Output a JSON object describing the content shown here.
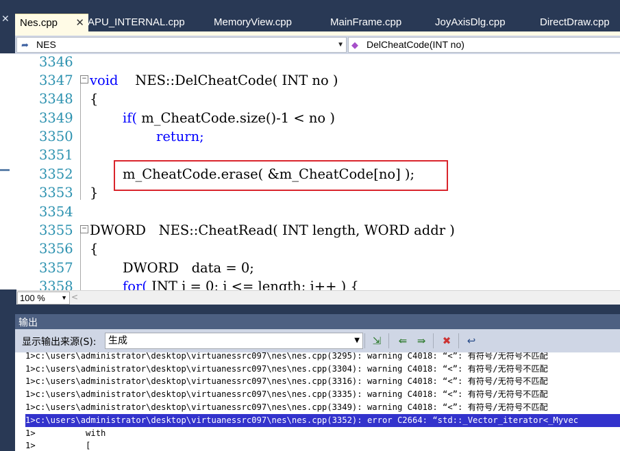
{
  "tabs": [
    {
      "label": "Nes.cpp",
      "active": true
    },
    {
      "label": "APU_INTERNAL.cpp"
    },
    {
      "label": "MemoryView.cpp"
    },
    {
      "label": "MainFrame.cpp"
    },
    {
      "label": "JoyAxisDlg.cpp"
    },
    {
      "label": "DirectDraw.cpp"
    }
  ],
  "tab_close_glyph": "✕",
  "nav": {
    "scope": "NES",
    "member": "DelCheatCode(INT no)"
  },
  "editor": {
    "lines": [
      {
        "num": "3346",
        "text": ""
      },
      {
        "num": "3347",
        "text": "NES::DelCheatCode( INT no )",
        "kw": "void"
      },
      {
        "num": "3348",
        "text": "{"
      },
      {
        "num": "3349",
        "text": "m_CheatCode.size()-1 < no )",
        "kw": "if("
      },
      {
        "num": "3350",
        "text": "",
        "kw": "return;"
      },
      {
        "num": "3351",
        "text": ""
      },
      {
        "num": "3352",
        "text": "m_CheatCode.erase( &m_CheatCode[no] );"
      },
      {
        "num": "3353",
        "text": "}"
      },
      {
        "num": "3354",
        "text": ""
      },
      {
        "num": "3355",
        "text": "DWORD   NES::CheatRead( INT length, WORD addr )"
      },
      {
        "num": "3356",
        "text": "{"
      },
      {
        "num": "3357",
        "text": "DWORD   data = 0;"
      },
      {
        "num": "3358",
        "text": "INT i = 0; i <= length; i++ ) {",
        "kw": "for("
      }
    ]
  },
  "zoom": "100 %",
  "output": {
    "title": "输出",
    "source_label": "显示输出来源(S):",
    "source_value": "生成",
    "lines": [
      "1>c:\\users\\administrator\\desktop\\virtuanessrc097\\nes\\nes.cpp(3295): warning C4018: “<”: 有符号/无符号不匹配",
      "1>c:\\users\\administrator\\desktop\\virtuanessrc097\\nes\\nes.cpp(3304): warning C4018: “<”: 有符号/无符号不匹配",
      "1>c:\\users\\administrator\\desktop\\virtuanessrc097\\nes\\nes.cpp(3316): warning C4018: “<”: 有符号/无符号不匹配",
      "1>c:\\users\\administrator\\desktop\\virtuanessrc097\\nes\\nes.cpp(3335): warning C4018: “<”: 有符号/无符号不匹配",
      "1>c:\\users\\administrator\\desktop\\virtuanessrc097\\nes\\nes.cpp(3349): warning C4018: “<”: 有符号/无符号不匹配",
      "1>c:\\users\\administrator\\desktop\\virtuanessrc097\\nes\\nes.cpp(3352): error C2664: “std::_Vector_iterator<_Myvec",
      "1>          with",
      "1>          ["
    ]
  }
}
